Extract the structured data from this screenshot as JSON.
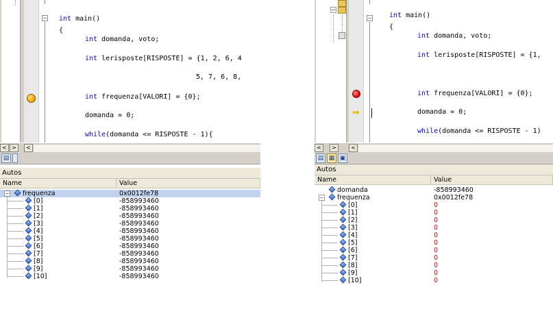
{
  "left": {
    "code_lines": [
      {
        "kw": "int",
        "rest": " main()"
      },
      {
        "kw": "",
        "rest": "{"
      },
      {
        "kw": "int",
        "rest": " domanda, voto;"
      },
      {
        "kw": "int",
        "rest": " lerisposte[RISPOSTE] = {1, 2, 6, 4"
      },
      {
        "kw": "",
        "rest": "5, 7, 6, 8,"
      },
      {
        "kw": "int",
        "rest": " frequenza[VALORI] = {0};"
      },
      {
        "kw": "",
        "rest": "domanda = 0;"
      },
      {
        "kw": "while",
        "rest": "(domanda <= RISPOSTE - 1){"
      }
    ],
    "scroll_left": "<",
    "scroll_right": ">",
    "autos": {
      "title": "Autos",
      "columns": [
        "Name",
        "Value"
      ],
      "rows": [
        {
          "name": "frequenza",
          "value": "0x0012fe78",
          "expander": "−",
          "level": 0,
          "selected": true,
          "changed": false
        },
        {
          "name": "[0]",
          "value": "-858993460",
          "level": 1,
          "changed": false
        },
        {
          "name": "[1]",
          "value": "-858993460",
          "level": 1,
          "changed": false
        },
        {
          "name": "[2]",
          "value": "-858993460",
          "level": 1,
          "changed": false
        },
        {
          "name": "[3]",
          "value": "-858993460",
          "level": 1,
          "changed": false
        },
        {
          "name": "[4]",
          "value": "-858993460",
          "level": 1,
          "changed": false
        },
        {
          "name": "[5]",
          "value": "-858993460",
          "level": 1,
          "changed": false
        },
        {
          "name": "[6]",
          "value": "-858993460",
          "level": 1,
          "changed": false
        },
        {
          "name": "[7]",
          "value": "-858993460",
          "level": 1,
          "changed": false
        },
        {
          "name": "[8]",
          "value": "-858993460",
          "level": 1,
          "changed": false
        },
        {
          "name": "[9]",
          "value": "-858993460",
          "level": 1,
          "changed": false
        },
        {
          "name": "[10]",
          "value": "-858993460",
          "level": 1,
          "changed": false
        }
      ]
    }
  },
  "right": {
    "code_lines": [
      {
        "kw": "int",
        "rest": " main()"
      },
      {
        "kw": "",
        "rest": "{"
      },
      {
        "kw": "int",
        "rest": " domanda, voto;"
      },
      {
        "kw": "int",
        "rest": " lerisposte[RISPOSTE] = {1,"
      },
      {
        "kw": "",
        "rest": "5,"
      },
      {
        "kw": "int",
        "rest": " frequenza[VALORI] = {0};"
      },
      {
        "kw": "",
        "rest": "domanda = 0;"
      },
      {
        "kw": "while",
        "rest": "(domanda <= RISPOSTE - 1)"
      }
    ],
    "scroll_left": "<",
    "scroll_right": ">",
    "autos": {
      "title": "Autos",
      "columns": [
        "Name",
        "Value"
      ],
      "rows": [
        {
          "name": "domanda",
          "value": "-858993460",
          "level": 0,
          "changed": false
        },
        {
          "name": "frequenza",
          "value": "0x0012fe78",
          "expander": "−",
          "level": 0,
          "changed": false
        },
        {
          "name": "[0]",
          "value": "0",
          "level": 1,
          "changed": true
        },
        {
          "name": "[1]",
          "value": "0",
          "level": 1,
          "changed": true
        },
        {
          "name": "[2]",
          "value": "0",
          "level": 1,
          "changed": true
        },
        {
          "name": "[3]",
          "value": "0",
          "level": 1,
          "changed": true
        },
        {
          "name": "[4]",
          "value": "0",
          "level": 1,
          "changed": true
        },
        {
          "name": "[5]",
          "value": "0",
          "level": 1,
          "changed": true
        },
        {
          "name": "[6]",
          "value": "0",
          "level": 1,
          "changed": true
        },
        {
          "name": "[7]",
          "value": "0",
          "level": 1,
          "changed": true
        },
        {
          "name": "[8]",
          "value": "0",
          "level": 1,
          "changed": true
        },
        {
          "name": "[9]",
          "value": "0",
          "level": 1,
          "changed": true
        },
        {
          "name": "[10]",
          "value": "0",
          "level": 1,
          "changed": true
        }
      ]
    }
  },
  "icons": {
    "breakpoint_left": "breakpoint-yellow-icon",
    "breakpoint_right": "breakpoint-red-icon",
    "current_line": "current-statement-arrow-icon",
    "variable": "variable-gem-icon"
  },
  "colors": {
    "changed_value": "#ff0000",
    "keyword": "#0000ff",
    "selection": "#c1d2ee"
  }
}
